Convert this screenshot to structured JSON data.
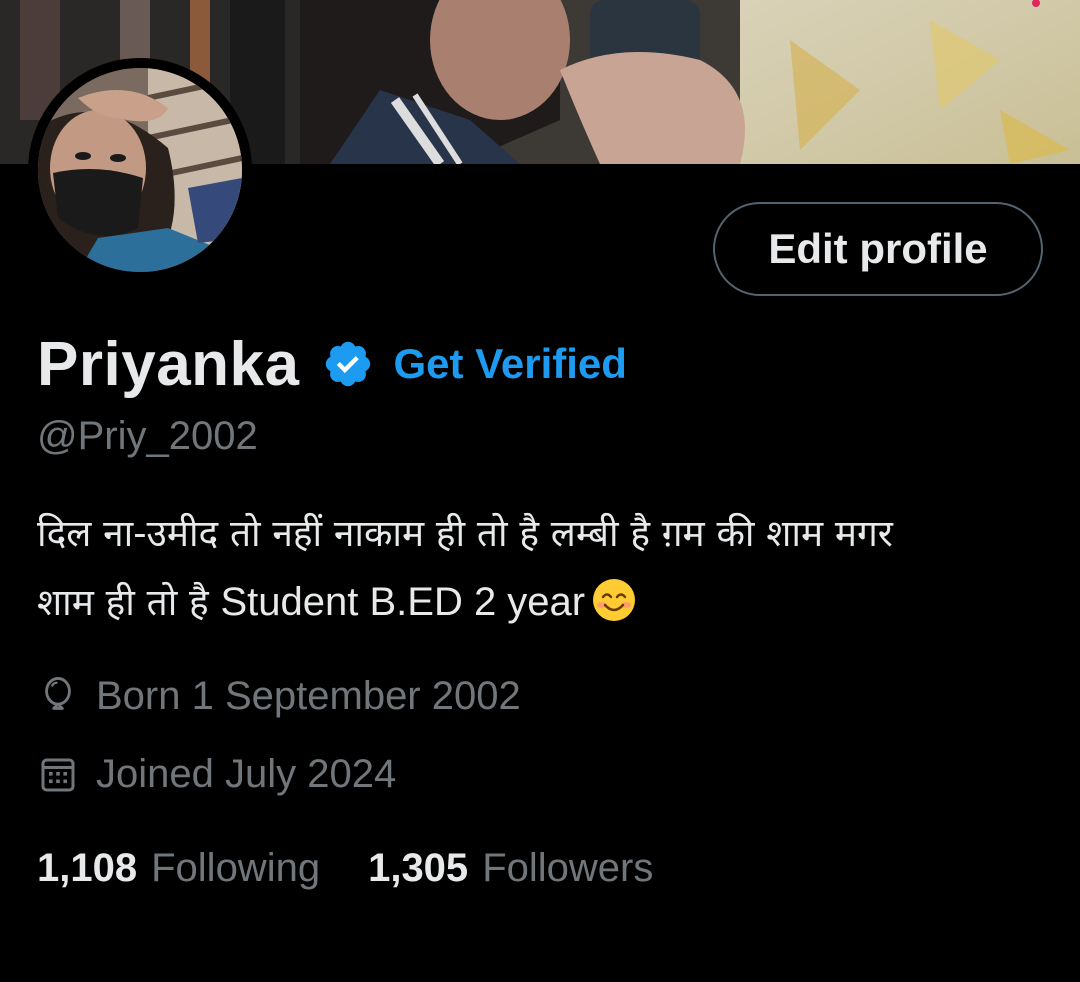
{
  "banner": {
    "alt": "profile banner photo"
  },
  "avatar": {
    "alt": "profile avatar photo"
  },
  "header": {
    "edit_profile_label": "Edit profile"
  },
  "profile": {
    "display_name": "Priyanka",
    "get_verified_label": "Get Verified",
    "handle": "@Priy_2002",
    "bio_hindi_1": "दिल ना-उमीद तो नहीं नाकाम ही तो है   लम्बी है ग़म की शाम मगर",
    "bio_hindi_2": "शाम ही तो है ",
    "bio_latin": "Student B.ED 2 year",
    "birthday": "Born 1 September 2002",
    "joined": "Joined July 2024"
  },
  "stats": {
    "following_count": "1,108",
    "following_label": "Following",
    "followers_count": "1,305",
    "followers_label": "Followers"
  },
  "colors": {
    "background": "#000000",
    "text_primary": "#e7e9ea",
    "text_secondary": "#71767b",
    "accent": "#1d9bf0",
    "border": "#536471"
  },
  "icons": {
    "verified": "verified-badge-icon",
    "birthday": "balloon-icon",
    "joined": "calendar-icon",
    "bio_emoji": "smiling-face-emoji"
  }
}
